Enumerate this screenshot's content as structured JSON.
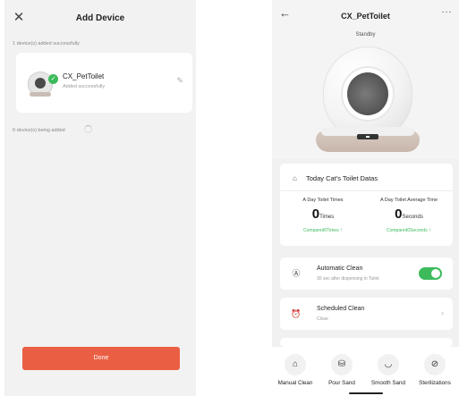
{
  "left_screen": {
    "header": {
      "title": "Add Device"
    },
    "success_note": "1 device(s) added successfully",
    "device_card": {
      "name": "CX_PetToilet",
      "status": "Added successfully"
    },
    "adding_note": "0 device(s) being added",
    "done_label": "Done"
  },
  "right_screen": {
    "header": {
      "title": "CX_PetToilet",
      "status": "Standby",
      "more": "···"
    },
    "data_card": {
      "title": "Today Cat's Toilet Datas",
      "day_times": {
        "label": "A Day Toilet Times",
        "value": "0",
        "unit": "Times",
        "compare": "Compared0Times"
      },
      "avg_time": {
        "label": "A Day Toilet Average Time",
        "value": "0",
        "unit": "Seconds",
        "compare": "Compared0Seconds"
      }
    },
    "auto_clean": {
      "title": "Automatic Clean",
      "subtitle": "30 sec after dispensing in Toilet",
      "enabled": true
    },
    "scheduled_clean": {
      "title": "Scheduled Clean",
      "subtitle": "Close"
    },
    "bottom_bar": {
      "manual": "Manual Clean",
      "pour": "Pour Sand",
      "smooth": "Smooth Sand",
      "steril": "Sterilizations"
    },
    "colors": {
      "accent_green": "#3dbb5c",
      "done_button": "#ea5f43"
    },
    "icons": {
      "back": "back-arrow-icon",
      "toilet": "toilet-icon",
      "auto": "auto-clean-icon",
      "alarm": "alarm-clock-icon",
      "manual": "manual-clean-icon",
      "pour": "pour-sand-icon",
      "smooth": "smooth-sand-icon",
      "steril": "sterilize-icon"
    }
  }
}
